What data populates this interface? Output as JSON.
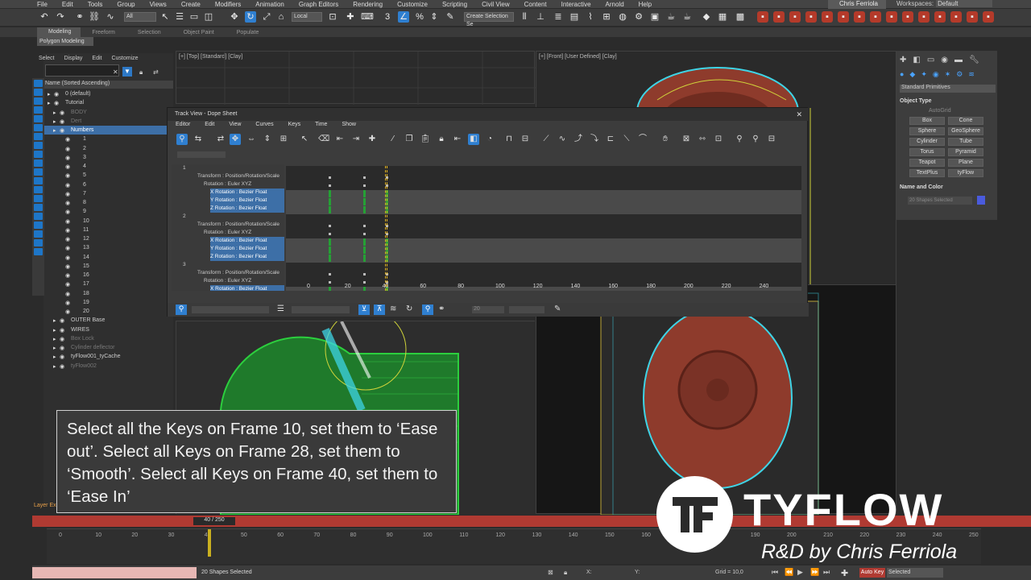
{
  "menubar": {
    "items": [
      "File",
      "Edit",
      "Tools",
      "Group",
      "Views",
      "Create",
      "Modifiers",
      "Animation",
      "Graph Editors",
      "Rendering",
      "Customize",
      "Scripting",
      "Civil View",
      "Content",
      "Interactive",
      "Arnold",
      "Help"
    ],
    "user": "Chris Ferriola",
    "workspaces_label": "Workspaces:",
    "workspace_value": "Default"
  },
  "toolbar": {
    "filter": "All",
    "coord": "Local",
    "selection_set": "Create Selection Se"
  },
  "ribbon": {
    "tabs": [
      "Modeling",
      "Freeform",
      "Selection",
      "Object Paint",
      "Populate"
    ],
    "sub_label": "Polygon Modeling"
  },
  "scene_explorer": {
    "menu": [
      "Select",
      "Display",
      "Edit",
      "Customize"
    ],
    "sort_header": "Name (Sorted Ascending)",
    "rows": [
      {
        "name": "0 (default)",
        "indent": 1,
        "state": "normal"
      },
      {
        "name": "Tutorial",
        "indent": 1,
        "state": "normal"
      },
      {
        "name": "BODY",
        "indent": 2,
        "state": "dim"
      },
      {
        "name": "Dert",
        "indent": 2,
        "state": "dim"
      },
      {
        "name": "Numbers",
        "indent": 2,
        "state": "sel"
      },
      {
        "name": "1",
        "indent": 3,
        "state": "normal"
      },
      {
        "name": "2",
        "indent": 3,
        "state": "normal"
      },
      {
        "name": "3",
        "indent": 3,
        "state": "normal"
      },
      {
        "name": "4",
        "indent": 3,
        "state": "normal"
      },
      {
        "name": "5",
        "indent": 3,
        "state": "normal"
      },
      {
        "name": "6",
        "indent": 3,
        "state": "normal"
      },
      {
        "name": "7",
        "indent": 3,
        "state": "normal"
      },
      {
        "name": "8",
        "indent": 3,
        "state": "normal"
      },
      {
        "name": "9",
        "indent": 3,
        "state": "normal"
      },
      {
        "name": "10",
        "indent": 3,
        "state": "normal"
      },
      {
        "name": "11",
        "indent": 3,
        "state": "normal"
      },
      {
        "name": "12",
        "indent": 3,
        "state": "normal"
      },
      {
        "name": "13",
        "indent": 3,
        "state": "normal"
      },
      {
        "name": "14",
        "indent": 3,
        "state": "normal"
      },
      {
        "name": "15",
        "indent": 3,
        "state": "normal"
      },
      {
        "name": "16",
        "indent": 3,
        "state": "normal"
      },
      {
        "name": "17",
        "indent": 3,
        "state": "normal"
      },
      {
        "name": "18",
        "indent": 3,
        "state": "normal"
      },
      {
        "name": "19",
        "indent": 3,
        "state": "normal"
      },
      {
        "name": "20",
        "indent": 3,
        "state": "normal"
      },
      {
        "name": "OUTER Base",
        "indent": 2,
        "state": "normal"
      },
      {
        "name": "WIRES",
        "indent": 2,
        "state": "normal"
      },
      {
        "name": "Box Lock",
        "indent": 2,
        "state": "dim"
      },
      {
        "name": "Cylinder deflector",
        "indent": 2,
        "state": "dim"
      },
      {
        "name": "tyFlow001_tyCache",
        "indent": 2,
        "state": "normal"
      },
      {
        "name": "tyFlow002",
        "indent": 2,
        "state": "dim"
      }
    ]
  },
  "viewports": {
    "top": "[+] [Top] [Standard] [Clay]",
    "front": "[+] [Front] [User Defined] [Clay]"
  },
  "command_panel": {
    "primitive_type": "Standard Primitives",
    "object_type_header": "Object Type",
    "autogrid": "AutoGrid",
    "buttons": [
      "Box",
      "Cone",
      "Sphere",
      "GeoSphere",
      "Cylinder",
      "Tube",
      "Torus",
      "Pyramid",
      "Teapot",
      "Plane",
      "TextPlus",
      "tyFlow"
    ],
    "name_color_header": "Name and Color",
    "name_field": "20 Shapes Selected",
    "swatch_color": "#4a5bdd"
  },
  "dope_sheet": {
    "title": "Track View - Dope Sheet",
    "menu": [
      "Editor",
      "Edit",
      "View",
      "Curves",
      "Keys",
      "Time",
      "Show"
    ],
    "tree": [
      {
        "label": "1",
        "level": 0,
        "sel": false
      },
      {
        "label": "Transform : Position/Rotation/Scale",
        "level": 1,
        "sel": false
      },
      {
        "label": "Rotation : Euler XYZ",
        "level": 2,
        "sel": false
      },
      {
        "label": "X Rotation : Bezier Float",
        "level": 3,
        "sel": true
      },
      {
        "label": "Y Rotation : Bezier Float",
        "level": 3,
        "sel": true
      },
      {
        "label": "Z Rotation : Bezier Float",
        "level": 3,
        "sel": true
      },
      {
        "label": "2",
        "level": 0,
        "sel": false
      },
      {
        "label": "Transform : Position/Rotation/Scale",
        "level": 1,
        "sel": false
      },
      {
        "label": "Rotation : Euler XYZ",
        "level": 2,
        "sel": false
      },
      {
        "label": "X Rotation : Bezier Float",
        "level": 3,
        "sel": true
      },
      {
        "label": "Y Rotation : Bezier Float",
        "level": 3,
        "sel": true
      },
      {
        "label": "Z Rotation : Bezier Float",
        "level": 3,
        "sel": true
      },
      {
        "label": "3",
        "level": 0,
        "sel": false
      },
      {
        "label": "Transform : Position/Rotation/Scale",
        "level": 1,
        "sel": false
      },
      {
        "label": "Rotation : Euler XYZ",
        "level": 2,
        "sel": false
      },
      {
        "label": "X Rotation : Bezier Float",
        "level": 3,
        "sel": true
      }
    ],
    "ticks": [
      "0",
      "20",
      "40",
      "60",
      "80",
      "100",
      "120",
      "140",
      "160",
      "180",
      "200",
      "220",
      "240"
    ],
    "key_frames_shown": [
      10,
      28,
      40
    ],
    "current_frame": 40,
    "bottom_field": "20"
  },
  "timeline": {
    "slider_text": "40 / 250",
    "current_frame": 40,
    "max_frame": 250,
    "ticks": [
      "0",
      "10",
      "20",
      "30",
      "40",
      "50",
      "60",
      "70",
      "80",
      "90",
      "100",
      "110",
      "120",
      "130",
      "140",
      "150",
      "160",
      "170",
      "180",
      "190",
      "200",
      "210",
      "220",
      "230",
      "240",
      "250"
    ],
    "layer_explorer": "Layer Ex"
  },
  "status": {
    "selection": "20 Shapes Selected",
    "x_label": "X:",
    "y_label": "Y:",
    "grid": "Grid = 10,0",
    "auto_key": "Auto Key",
    "selected": "Selected"
  },
  "caption": {
    "text": "Select all the Keys on Frame 10, set them to ‘Ease out’.  Select all Keys on Frame 28, set them to ‘Smooth’.  Select all Keys on Frame 40, set them to ‘Ease In’"
  },
  "branding": {
    "logo_mark": "TF",
    "wordmark": "TYFLOW",
    "credit": "R&D by Chris Ferriola"
  },
  "colors": {
    "accent": "#2f7fd0",
    "timeline_red": "#b03a32",
    "key_green": "#25a035",
    "current_frame_yellow": "#e6b51f",
    "model_red": "#8e3b2c",
    "cyan_outline": "#3ed4e6",
    "green_wire": "#2ccf3e"
  }
}
